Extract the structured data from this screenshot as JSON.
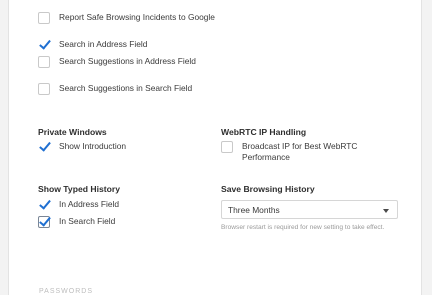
{
  "general_options": [
    {
      "label": "Report Safe Browsing Incidents to Google",
      "checked": false
    },
    {
      "label": "Search in Address Field",
      "checked": true
    },
    {
      "label": "Search Suggestions in Address Field",
      "checked": false
    },
    {
      "label": "Search Suggestions in Search Field",
      "checked": false
    }
  ],
  "private_windows": {
    "title": "Private Windows",
    "options": [
      {
        "label": "Show Introduction",
        "checked": true
      }
    ]
  },
  "webrtc": {
    "title": "WebRTC IP Handling",
    "options": [
      {
        "label": "Broadcast IP for Best WebRTC Performance",
        "checked": false
      }
    ]
  },
  "typed_history": {
    "title": "Show Typed History",
    "options": [
      {
        "label": "In Address Field",
        "checked": true
      },
      {
        "label": "In Search Field",
        "checked": true
      }
    ]
  },
  "save_history": {
    "title": "Save Browsing History",
    "selected": "Three Months",
    "hint": "Browser restart is required for new setting to take effect."
  },
  "next_section_partial": "PASSWORDS"
}
